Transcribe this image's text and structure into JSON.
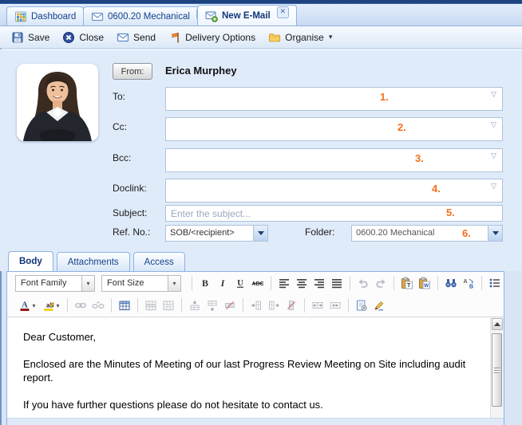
{
  "tab_bar": {
    "tabs": [
      {
        "label": "Dashboard",
        "icon": "dashboard-grid-icon",
        "closable": false,
        "active": false
      },
      {
        "label": "0600.20 Mechanical",
        "icon": "mail-icon",
        "closable": true,
        "active": false
      },
      {
        "label": "New E-Mail",
        "icon": "mail-new-icon",
        "closable": true,
        "active": true
      }
    ]
  },
  "toolbar": {
    "buttons": [
      {
        "label": "Save",
        "icon": "save-icon"
      },
      {
        "label": "Close",
        "icon": "close-circle-icon"
      },
      {
        "label": "Send",
        "icon": "send-mail-icon"
      },
      {
        "label": "Delivery Options",
        "icon": "delivery-flag-icon"
      },
      {
        "label": "Organise",
        "icon": "organise-folder-icon",
        "has_menu": true
      }
    ]
  },
  "compose": {
    "from_button": "From:",
    "from_name": "Erica Murphey",
    "recipient_fields": [
      {
        "label": "To:",
        "annotation": "1."
      },
      {
        "label": "Cc:",
        "annotation": "2."
      },
      {
        "label": "Bcc:",
        "annotation": "3."
      },
      {
        "label": "Doclink:",
        "annotation": "4."
      }
    ],
    "subject": {
      "label": "Subject:",
      "placeholder": "Enter the subject...",
      "annotation": "5."
    },
    "ref_no": {
      "label": "Ref. No.:",
      "value": "SOB/<recipient>"
    },
    "folder": {
      "label": "Folder:",
      "value": "0600.20 Mechanical",
      "annotation": "6."
    }
  },
  "content_tabs": [
    {
      "label": "Body",
      "active": true
    },
    {
      "label": "Attachments",
      "active": false
    },
    {
      "label": "Access",
      "active": false
    }
  ],
  "editor": {
    "font_family": "Font Family",
    "font_size": "Font Size",
    "toolbar_row1": [
      "font-family-select",
      "font-size-select",
      "|",
      "bold",
      "italic",
      "underline",
      "strikethrough",
      "|",
      "align-left",
      "align-center",
      "align-right",
      "align-justify",
      "|",
      "undo:disabled",
      "redo:disabled",
      "|",
      "paste-text",
      "paste-word",
      "|",
      "find",
      "replace",
      "|",
      "bullet-list",
      "numbered-list",
      "|",
      "outdent"
    ],
    "toolbar_row2": [
      "font-color",
      "highlight",
      "|",
      "link:disabled",
      "unlink:disabled",
      "|",
      "insert-table",
      "|",
      "row-props:disabled",
      "cell-props:disabled",
      "|",
      "row-before:disabled",
      "row-after:disabled",
      "delete-row:disabled",
      "|",
      "col-before:disabled",
      "col-after:disabled",
      "delete-col:disabled",
      "|",
      "split-cells:disabled",
      "merge-cells:disabled",
      "|",
      "html-source",
      "signature"
    ],
    "body_paragraphs": [
      "Dear Customer,",
      "Enclosed are the Minutes of Meeting of our last Progress Review Meeting on Site including audit report.",
      "If you have further questions please do not hesitate to contact us."
    ]
  },
  "colors": {
    "accent_orange": "#f3701e",
    "navy": "#15428b",
    "tab_border": "#8db2e3",
    "top_strip": "#1d4380"
  }
}
